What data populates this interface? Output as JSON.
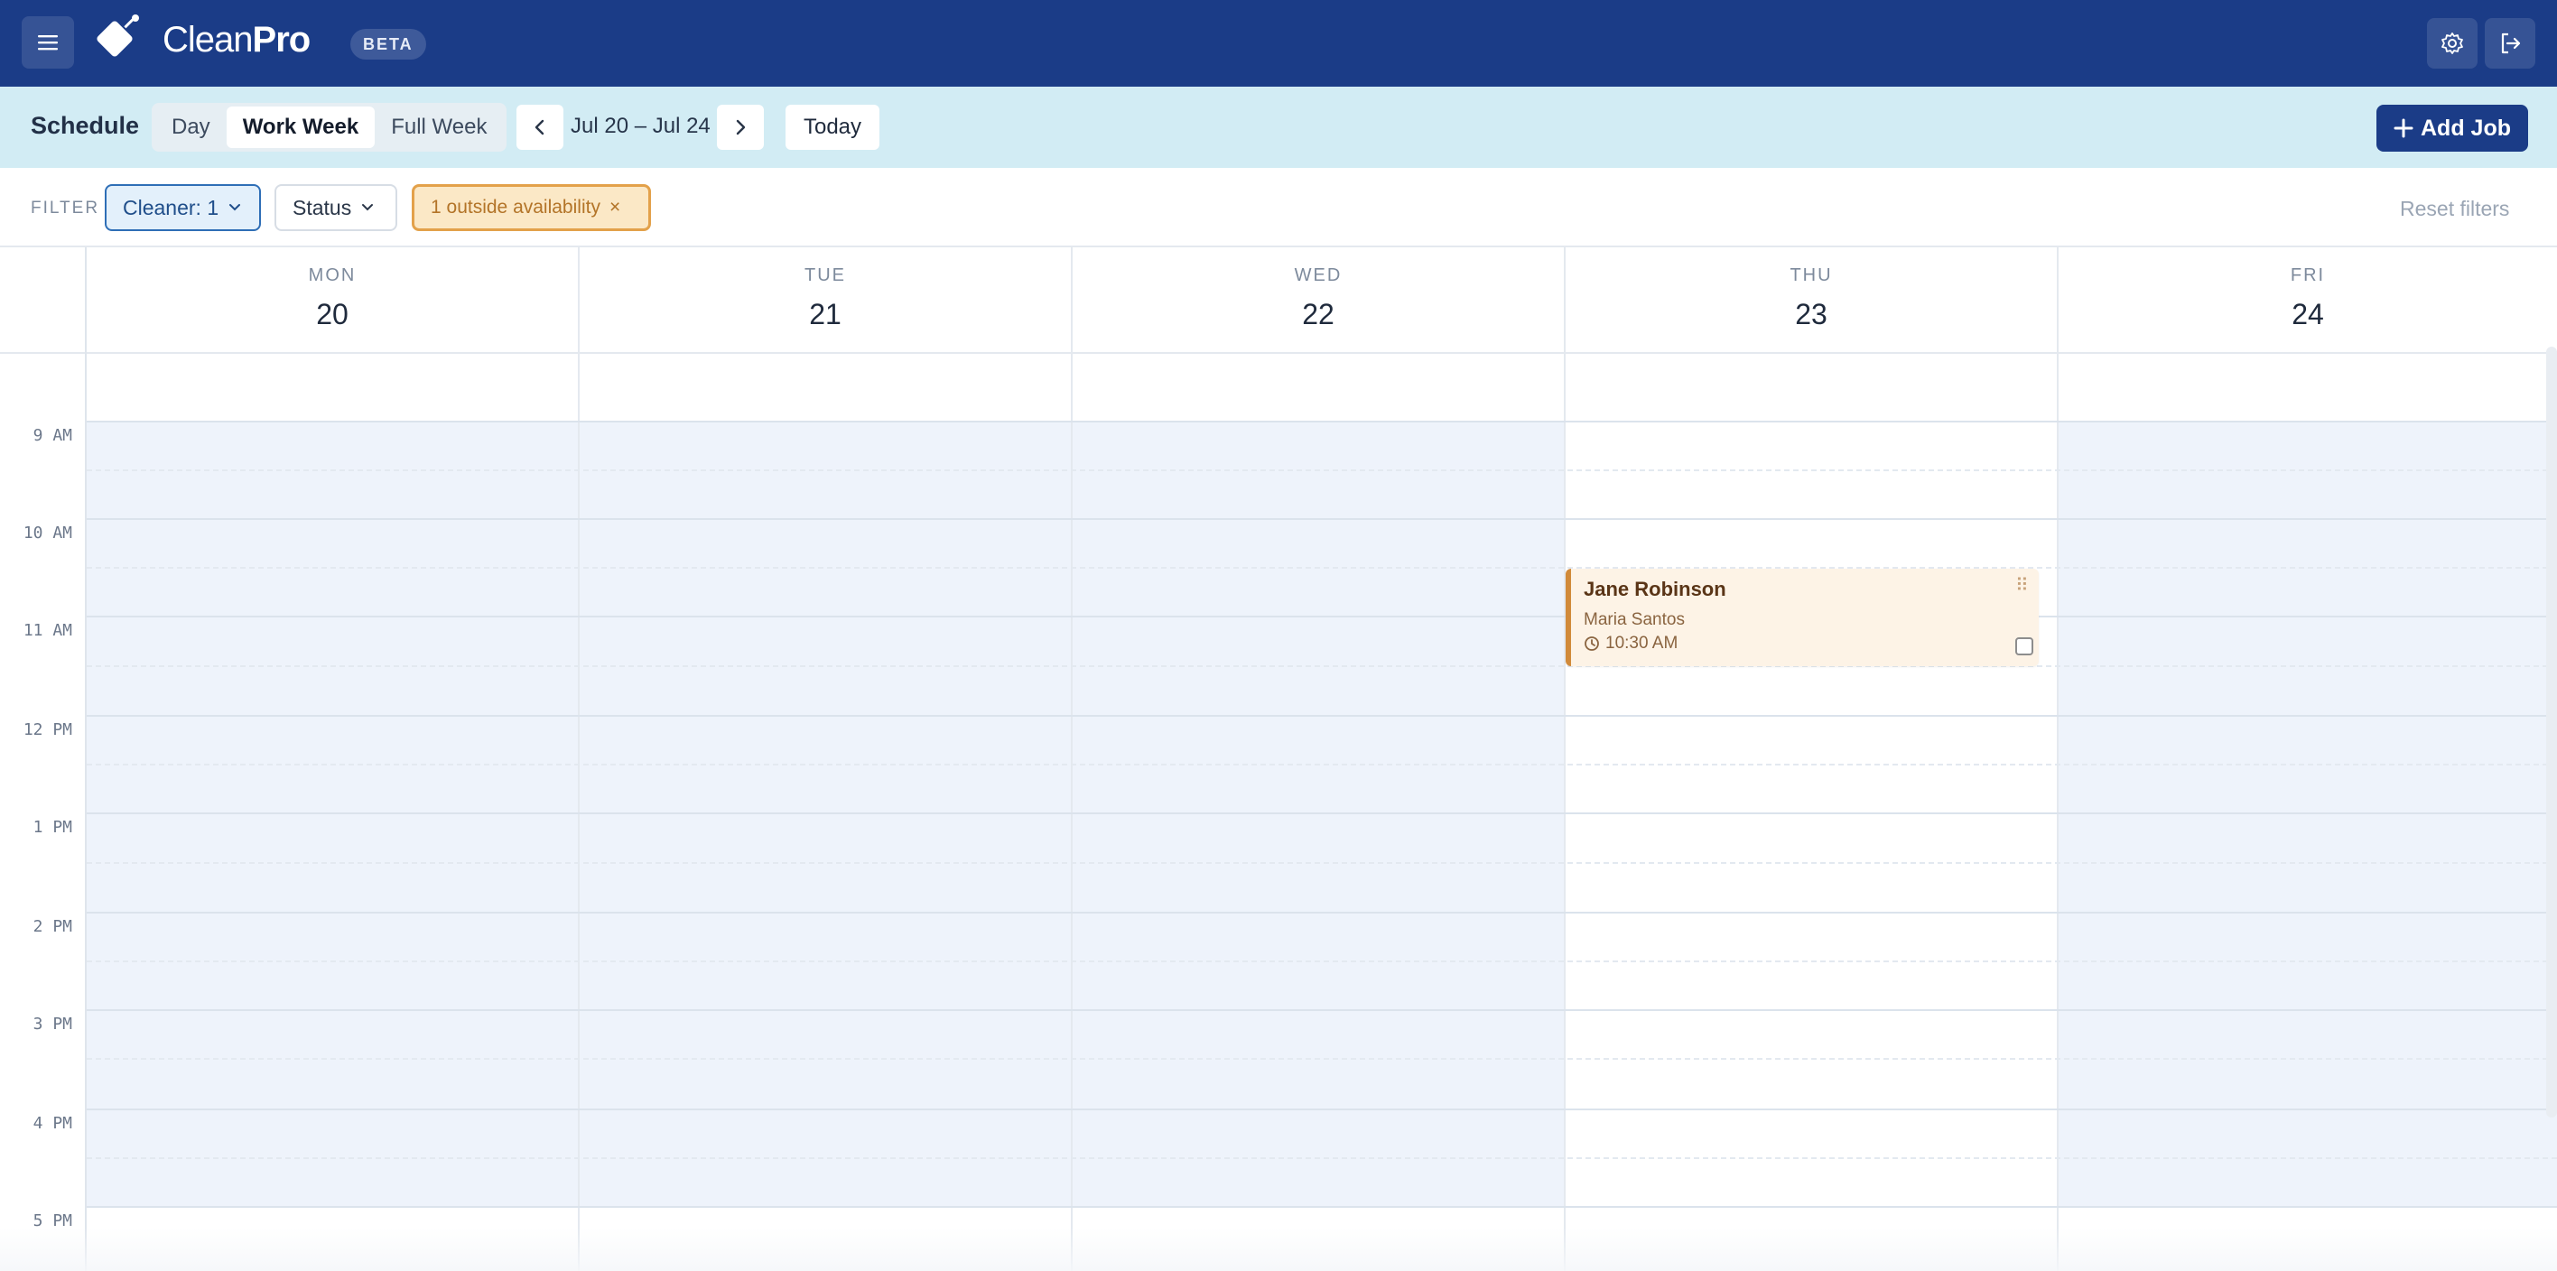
{
  "app": {
    "brand_light": "Clean",
    "brand_bold": "Pro",
    "badge": "BETA",
    "colors": {
      "primary": "#1b3c87",
      "toolbar_bg": "#d2ecf4",
      "available_band": "#eef3fb",
      "event_accent": "#d18a3a"
    }
  },
  "toolbar": {
    "title": "Schedule",
    "views": [
      {
        "label": "Day",
        "active": false
      },
      {
        "label": "Work Week",
        "active": true
      },
      {
        "label": "Full Week",
        "active": false
      }
    ],
    "range": "Jul 20 – Jul 24",
    "today_label": "Today",
    "add_job_label": "Add Job",
    "icons": {
      "prev": "chevron-left-icon",
      "next": "chevron-right-icon",
      "add": "plus-icon"
    }
  },
  "filters": {
    "label": "FILTER",
    "cleaner": "Cleaner: 1",
    "status": "Status",
    "outside": "1 outside availability",
    "outside_remove": "×",
    "reset_label": "Reset filters"
  },
  "calendar": {
    "days": [
      {
        "name": "MON",
        "num": "20"
      },
      {
        "name": "TUE",
        "num": "21"
      },
      {
        "name": "WED",
        "num": "22"
      },
      {
        "name": "THU",
        "num": "23"
      },
      {
        "name": "FRI",
        "num": "24"
      }
    ],
    "hours": [
      "9 AM",
      "10 AM",
      "11 AM",
      "12 PM",
      "1 PM",
      "2 PM",
      "3 PM",
      "4 PM",
      "5 PM"
    ],
    "events": [
      {
        "day": "THU",
        "title": "Jane Robinson",
        "cleaner": "Maria Santos",
        "time": "10:30 AM"
      }
    ]
  }
}
